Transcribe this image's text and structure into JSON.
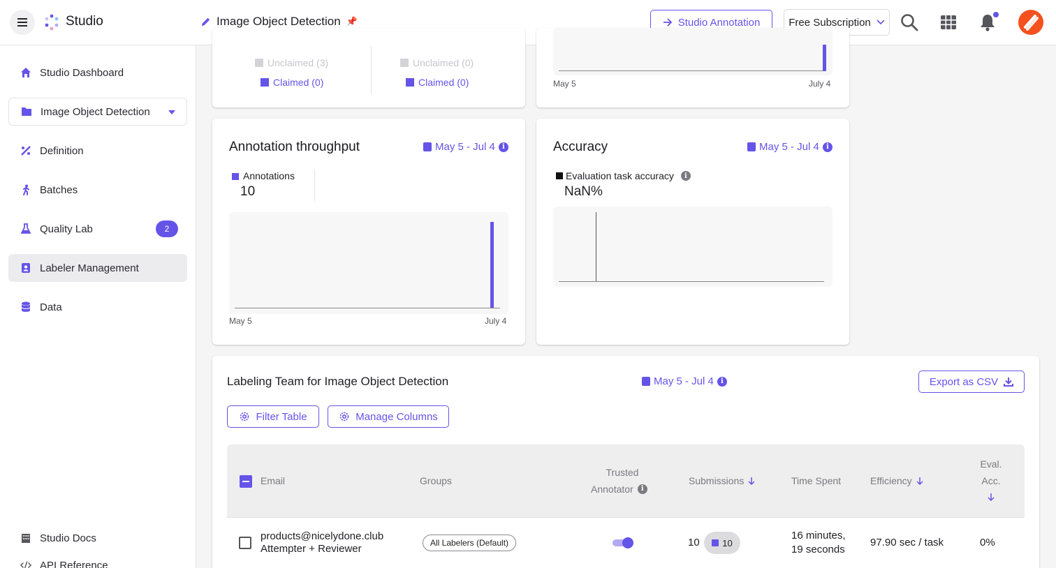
{
  "topbar": {
    "app_name": "Studio",
    "project_title": "Image Object Detection",
    "annotation_button": "Studio Annotation",
    "subscription": "Free Subscription"
  },
  "sidebar": {
    "items": [
      {
        "label": "Studio Dashboard",
        "icon": "home-icon"
      },
      {
        "label": "Image Object Detection",
        "icon": "folder-icon"
      },
      {
        "label": "Definition",
        "icon": "definition-icon"
      },
      {
        "label": "Batches",
        "icon": "runner-icon"
      },
      {
        "label": "Quality Lab",
        "icon": "flask-icon",
        "badge": "2"
      },
      {
        "label": "Labeler Management",
        "icon": "contact-icon"
      },
      {
        "label": "Data",
        "icon": "database-icon"
      }
    ],
    "footer": [
      {
        "label": "Studio Docs",
        "icon": "building-icon"
      },
      {
        "label": "API Reference",
        "icon": "code-icon"
      }
    ]
  },
  "top_cards": {
    "left": {
      "col1": {
        "unclaimed": "Unclaimed (3)",
        "claimed": "Claimed (0)"
      },
      "col2": {
        "unclaimed": "Unclaimed (0)",
        "claimed": "Claimed (0)"
      }
    },
    "right": {
      "x_start": "May 5",
      "x_end": "July 4"
    }
  },
  "throughput": {
    "title": "Annotation throughput",
    "date_range": "May 5 - Jul 4",
    "legend": "Annotations",
    "total": "10",
    "x_start": "May 5",
    "x_end": "July 4"
  },
  "accuracy": {
    "title": "Accuracy",
    "date_range": "May 5 - Jul 4",
    "legend": "Evaluation task accuracy",
    "value": "NaN%"
  },
  "team": {
    "title": "Labeling Team for Image Object Detection",
    "date_range": "May 5 - Jul 4",
    "export_button": "Export as CSV",
    "filter_button": "Filter Table",
    "columns_button": "Manage Columns",
    "headers": {
      "email": "Email",
      "groups": "Groups",
      "trusted_1": "Trusted",
      "trusted_2": "Annotator",
      "submissions": "Submissions",
      "time_spent": "Time Spent",
      "efficiency": "Efficiency",
      "eval_1": "Eval.",
      "eval_2": "Acc."
    },
    "rows": [
      {
        "email": "products@nicelydone.club",
        "role": "Attempter + Reviewer",
        "group": "All Labelers (Default)",
        "trusted": true,
        "submissions": "10",
        "submissions_pill": "10",
        "time_1": "16 minutes,",
        "time_2": "19 seconds",
        "efficiency": "97.90 sec / task",
        "eval_acc": "0%"
      }
    ]
  },
  "colors": {
    "accent": "#6554e8",
    "avatar": "#f4511e",
    "unclaimed": "#d4d4d8"
  },
  "chart_data": [
    {
      "type": "bar",
      "x": [
        "May 5",
        "July 4"
      ],
      "series": [
        {
          "name": "Annotations",
          "values": [
            0,
            10
          ]
        }
      ]
    },
    {
      "type": "line",
      "series": [
        {
          "name": "Evaluation task accuracy",
          "values": []
        }
      ]
    }
  ]
}
